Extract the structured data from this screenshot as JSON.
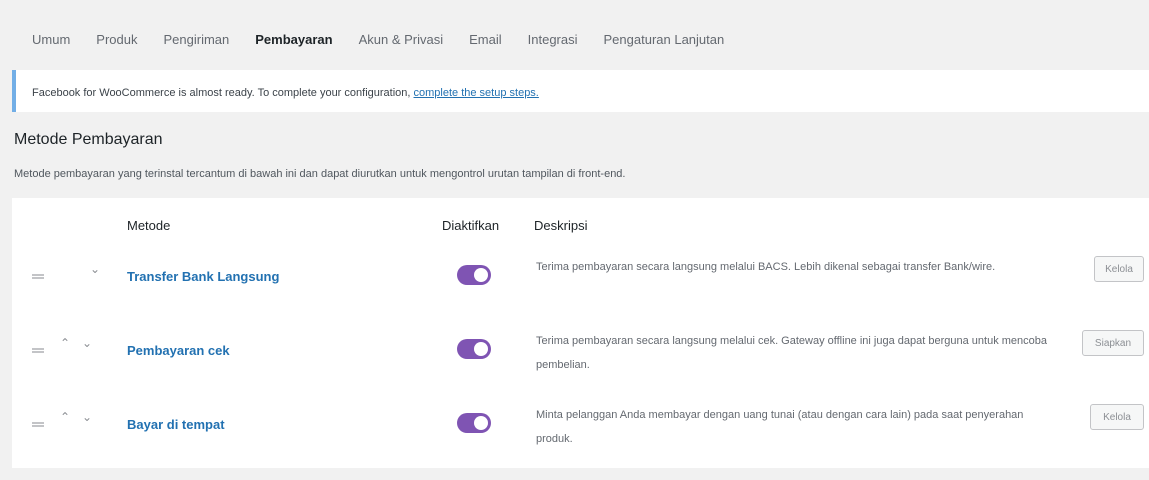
{
  "tabs": [
    "Umum",
    "Produk",
    "Pengiriman",
    "Pembayaran",
    "Akun & Privasi",
    "Email",
    "Integrasi",
    "Pengaturan Lanjutan"
  ],
  "active_tab": "Pembayaran",
  "notice": {
    "text": "Facebook for WooCommerce is almost ready. To complete your configuration,",
    "link": "complete the setup steps."
  },
  "section": {
    "title": "Metode Pembayaran",
    "description": "Metode pembayaran yang terinstal tercantum di bawah ini dan dapat diurutkan untuk mengontrol urutan tampilan di front-end."
  },
  "table": {
    "headers": {
      "method": "Metode",
      "enabled": "Diaktifkan",
      "description": "Deskripsi"
    },
    "rows": [
      {
        "name": "Transfer Bank Langsung",
        "enabled": true,
        "description": "Terima pembayaran secara langsung melalui BACS. Lebih dikenal sebagai transfer Bank/wire.",
        "action": "Kelola"
      },
      {
        "name": "Pembayaran cek",
        "enabled": true,
        "description": "Terima pembayaran secara langsung melalui cek. Gateway offline ini juga dapat berguna untuk mencoba pembelian.",
        "action": "Siapkan"
      },
      {
        "name": "Bayar di tempat",
        "enabled": true,
        "description": "Minta pelanggan Anda membayar dengan uang tunai (atau dengan cara lain) pada saat penyerahan produk.",
        "action": "Kelola"
      }
    ]
  },
  "colors": {
    "toggle_on": "#7f54b3",
    "link": "#2271b1",
    "notice_border": "#72aee6"
  }
}
